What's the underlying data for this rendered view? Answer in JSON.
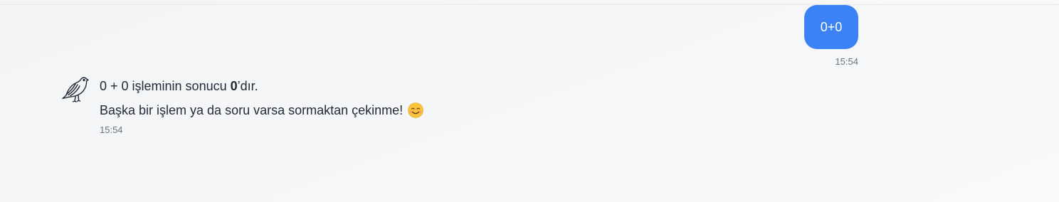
{
  "conversation": {
    "user_message": {
      "text": "0+0",
      "time": "15:54"
    },
    "assistant_message": {
      "avatar_icon": "dove-icon",
      "line1_prefix": "0 + 0 işleminin sonucu ",
      "line1_bold": "0",
      "line1_suffix": "’dır.",
      "line2": "Başka bir işlem ya da soru varsa sormaktan çekinme!",
      "emoji_icon": "smiling-face-icon",
      "time": "15:54"
    }
  },
  "colors": {
    "user_bubble": "#3b82f6",
    "timestamp": "#6b7280",
    "text": "#1f2937"
  }
}
